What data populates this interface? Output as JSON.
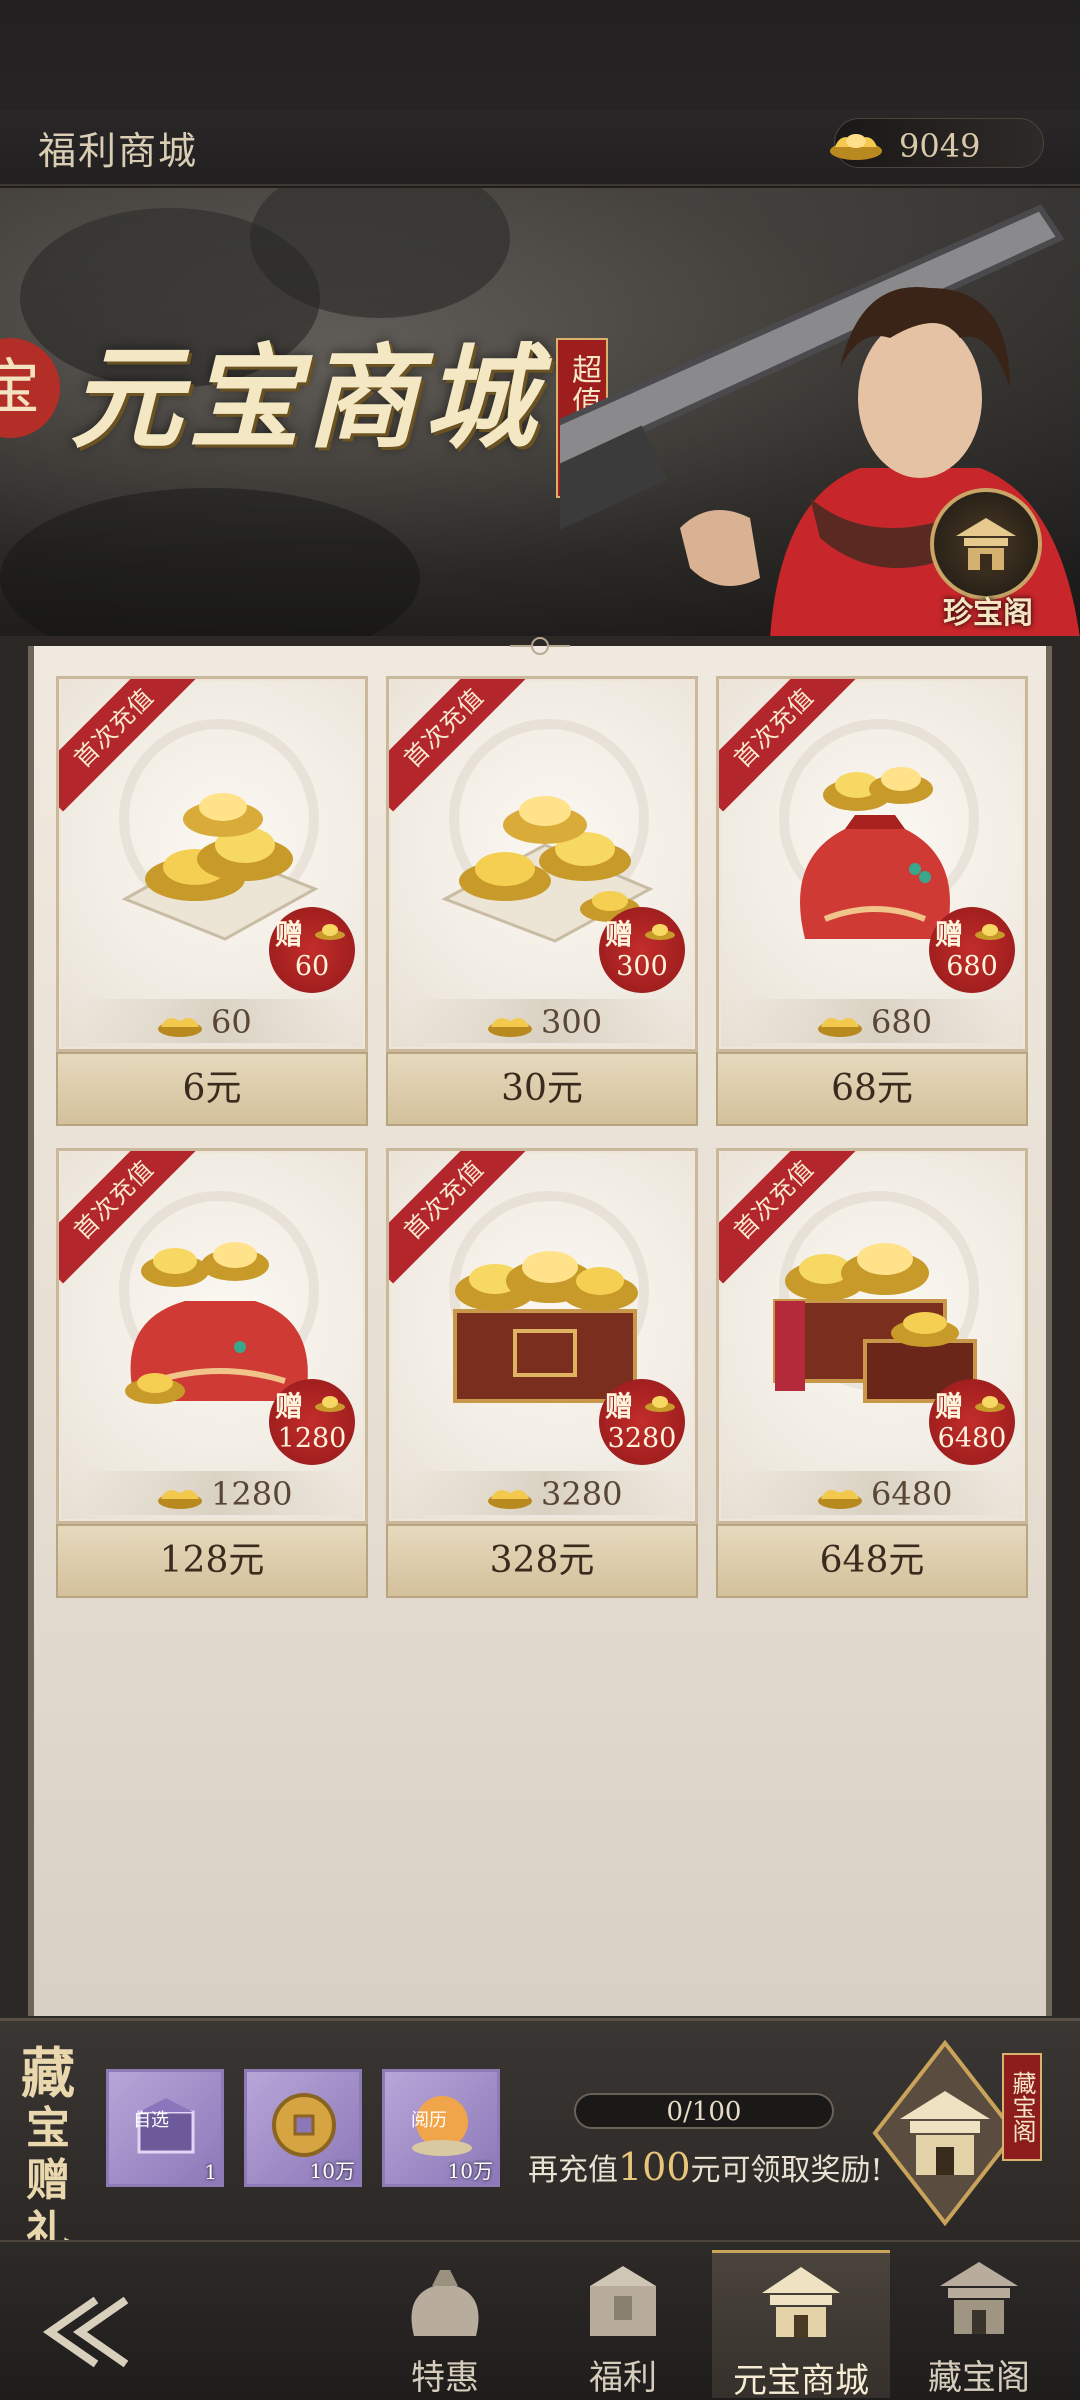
{
  "header": {
    "title": "福利商城",
    "currency_amount": "9049"
  },
  "banner": {
    "title": "元宝商城",
    "tag": "超值商品",
    "treasure_label": "珍宝阁"
  },
  "products": [
    {
      "ribbon": "首次充值",
      "bonus_label": "赠",
      "bonus": "60",
      "amount": "60",
      "price": "6元"
    },
    {
      "ribbon": "首次充值",
      "bonus_label": "赠",
      "bonus": "300",
      "amount": "300",
      "price": "30元"
    },
    {
      "ribbon": "首次充值",
      "bonus_label": "赠",
      "bonus": "680",
      "amount": "680",
      "price": "68元"
    },
    {
      "ribbon": "首次充值",
      "bonus_label": "赠",
      "bonus": "1280",
      "amount": "1280",
      "price": "128元"
    },
    {
      "ribbon": "首次充值",
      "bonus_label": "赠",
      "bonus": "3280",
      "amount": "3280",
      "price": "328元"
    },
    {
      "ribbon": "首次充值",
      "bonus_label": "赠",
      "bonus": "6480",
      "amount": "6480",
      "price": "648元"
    }
  ],
  "treasure_gift": {
    "title_chars": [
      "藏",
      "宝",
      "赠",
      "礼"
    ],
    "rewards": [
      {
        "label": "自选",
        "qty": "1"
      },
      {
        "label": "",
        "qty": "10万"
      },
      {
        "label": "阅历",
        "qty": "10万"
      }
    ],
    "progress_text": "0/100",
    "progress_fraction": 0,
    "hint_prefix": "再充值",
    "hint_amount": "100",
    "hint_suffix": "元可领取奖励!",
    "pavilion_tag": "藏宝阁"
  },
  "nav": {
    "items": [
      {
        "label": "特惠",
        "active": false
      },
      {
        "label": "福利",
        "active": false
      },
      {
        "label": "元宝商城",
        "active": true
      },
      {
        "label": "藏宝阁",
        "active": false
      }
    ]
  },
  "colors": {
    "accent_gold": "#c9a35a",
    "ribbon_red": "#b3262b",
    "panel_paper": "#efe9df"
  }
}
